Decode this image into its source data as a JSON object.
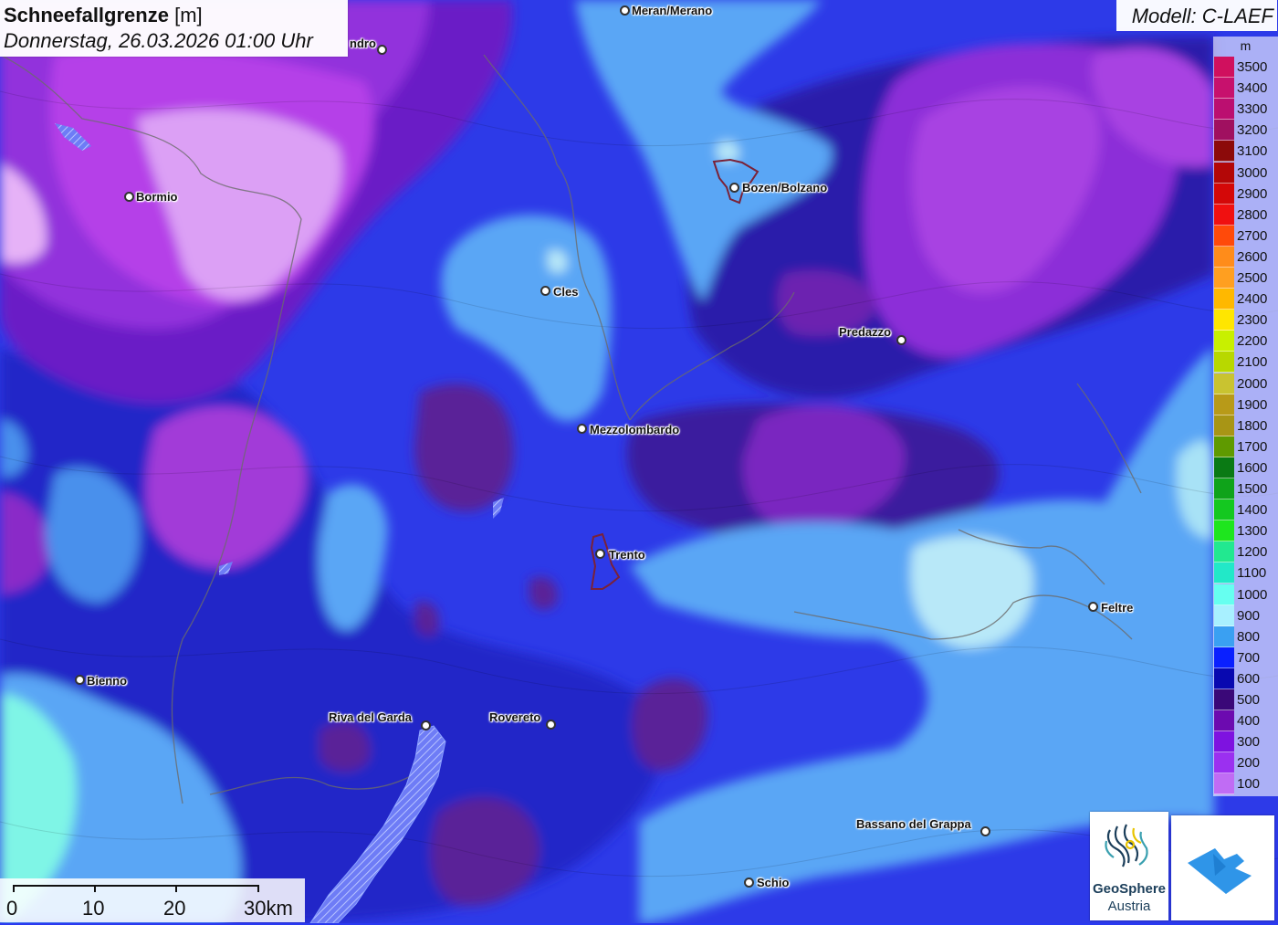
{
  "map": {
    "title": "Schneefallgrenze",
    "unit_suffix": "[m]",
    "subtitle": "Donnerstag, 26.03.2026 01:00 Uhr",
    "model": "Modell: C-LAEF"
  },
  "legend": {
    "unit": "m",
    "items": [
      {
        "label": "3500",
        "color": "#d0105e"
      },
      {
        "label": "3400",
        "color": "#c7116d"
      },
      {
        "label": "3300",
        "color": "#bb0f70"
      },
      {
        "label": "3200",
        "color": "#a01060"
      },
      {
        "label": "3100",
        "color": "#8c0a0a"
      },
      {
        "label": "3000",
        "color": "#b30707"
      },
      {
        "label": "2900",
        "color": "#d40808"
      },
      {
        "label": "2800",
        "color": "#f01010"
      },
      {
        "label": "2700",
        "color": "#ff4a0a"
      },
      {
        "label": "2600",
        "color": "#ff8c1a"
      },
      {
        "label": "2500",
        "color": "#ff9f20"
      },
      {
        "label": "2400",
        "color": "#ffb800"
      },
      {
        "label": "2300",
        "color": "#ffe600"
      },
      {
        "label": "2200",
        "color": "#c8f000"
      },
      {
        "label": "2100",
        "color": "#b8d800"
      },
      {
        "label": "2000",
        "color": "#c9c330"
      },
      {
        "label": "1900",
        "color": "#b89a18"
      },
      {
        "label": "1800",
        "color": "#a89515"
      },
      {
        "label": "1700",
        "color": "#5f9a00"
      },
      {
        "label": "1600",
        "color": "#0a7a14"
      },
      {
        "label": "1500",
        "color": "#0fa31a"
      },
      {
        "label": "1400",
        "color": "#14c820"
      },
      {
        "label": "1300",
        "color": "#1ee61e"
      },
      {
        "label": "1200",
        "color": "#22e890"
      },
      {
        "label": "1100",
        "color": "#22e8c8"
      },
      {
        "label": "1000",
        "color": "#66fff0"
      },
      {
        "label": "900",
        "color": "#a8f0ff"
      },
      {
        "label": "800",
        "color": "#3aa0f2"
      },
      {
        "label": "700",
        "color": "#0a20ff"
      },
      {
        "label": "600",
        "color": "#0808b0"
      },
      {
        "label": "500",
        "color": "#3a0878"
      },
      {
        "label": "400",
        "color": "#6c0ab0"
      },
      {
        "label": "300",
        "color": "#7e12e0"
      },
      {
        "label": "200",
        "color": "#9b30f0"
      },
      {
        "label": "100",
        "color": "#c06cf4"
      }
    ]
  },
  "cities": [
    {
      "name": "Meran/Merano"
    },
    {
      "name": "ndro"
    },
    {
      "name": "Bormio"
    },
    {
      "name": "Bozen/Bolzano"
    },
    {
      "name": "Cles"
    },
    {
      "name": "Predazzo"
    },
    {
      "name": "Mezzolombardo"
    },
    {
      "name": "Trento"
    },
    {
      "name": "Feltre"
    },
    {
      "name": "Bienno"
    },
    {
      "name": "Riva del Garda"
    },
    {
      "name": "Rovereto"
    },
    {
      "name": "Bassano del Grappa"
    },
    {
      "name": "Schio"
    }
  ],
  "scale": {
    "labels": [
      "0",
      "10",
      "20",
      "30km"
    ]
  },
  "logos": {
    "geosphere_line1": "GeoSphere",
    "geosphere_line2": "Austria"
  }
}
